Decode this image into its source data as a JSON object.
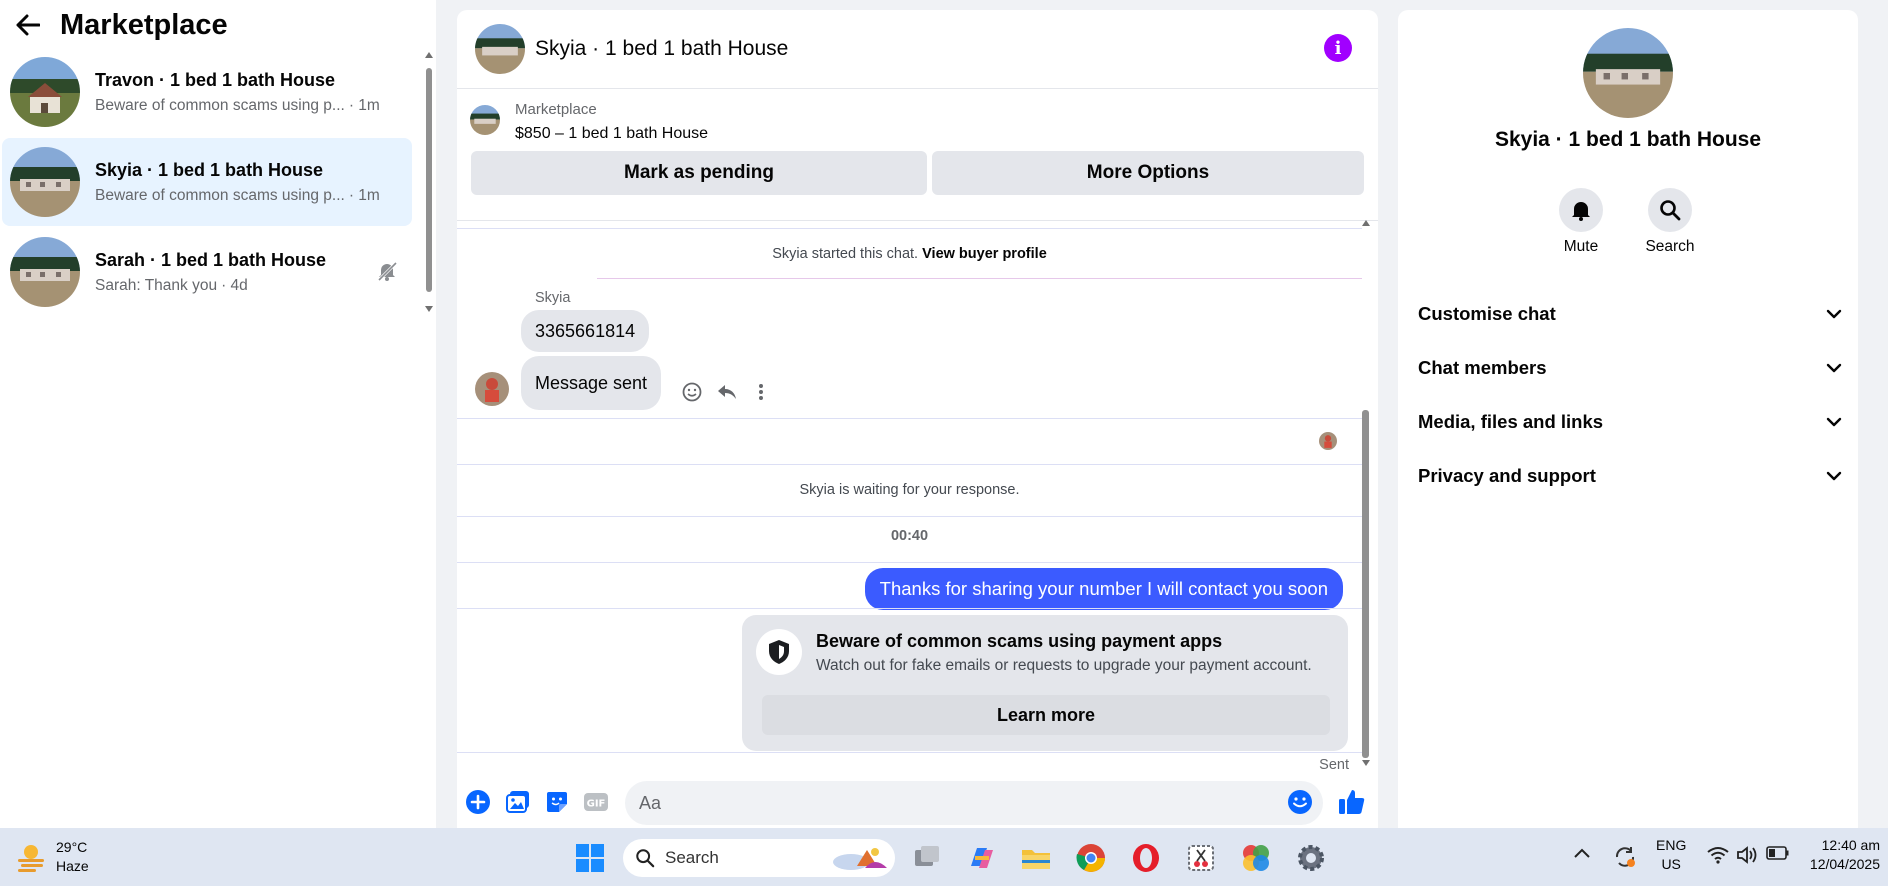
{
  "sidebar": {
    "title": "Marketplace",
    "conversations": [
      {
        "name": "Travon · 1 bed 1 bath House",
        "preview": "Beware of common scams using p...",
        "time": "· 1m"
      },
      {
        "name": "Skyia · 1 bed 1 bath House",
        "preview": "Beware of common scams using p...",
        "time": "· 1m"
      },
      {
        "name": "Sarah · 1 bed 1 bath House",
        "preview": "Sarah: Thank you",
        "time": "· 4d"
      }
    ]
  },
  "chat": {
    "title": "Skyia · 1 bed 1 bath House",
    "listing": {
      "label": "Marketplace",
      "price": "$850 – 1 bed 1 bath House"
    },
    "buttons": {
      "pending": "Mark as pending",
      "more": "More Options"
    },
    "started": "Skyia started this chat.",
    "view_profile": "View buyer profile",
    "sender": "Skyia",
    "msg_number": "3365661814",
    "msg_sent": "Message sent",
    "waiting": "Skyia is waiting for your response.",
    "timestamp": "00:40",
    "outgoing": "Thanks for sharing your number I will contact you soon",
    "scam": {
      "title": "Beware of common scams using payment apps",
      "body": "Watch out for fake emails or requests to upgrade your payment account.",
      "button": "Learn more"
    },
    "status": "Sent",
    "composer_placeholder": "Aa"
  },
  "right_panel": {
    "name": "Skyia · 1 bed 1 bath House",
    "actions": {
      "mute": "Mute",
      "search": "Search"
    },
    "sections": [
      "Customise chat",
      "Chat members",
      "Media, files and links",
      "Privacy and support"
    ]
  },
  "taskbar": {
    "weather_temp": "29°C",
    "weather_desc": "Haze",
    "search": "Search",
    "lang": "ENG",
    "region": "US",
    "time": "12:40 am",
    "date": "12/04/2025"
  },
  "colors": {
    "accent": "#0866ff",
    "bubble_out": "#3b5bff",
    "info": "#a100ff",
    "active_row": "#e7f3ff"
  }
}
